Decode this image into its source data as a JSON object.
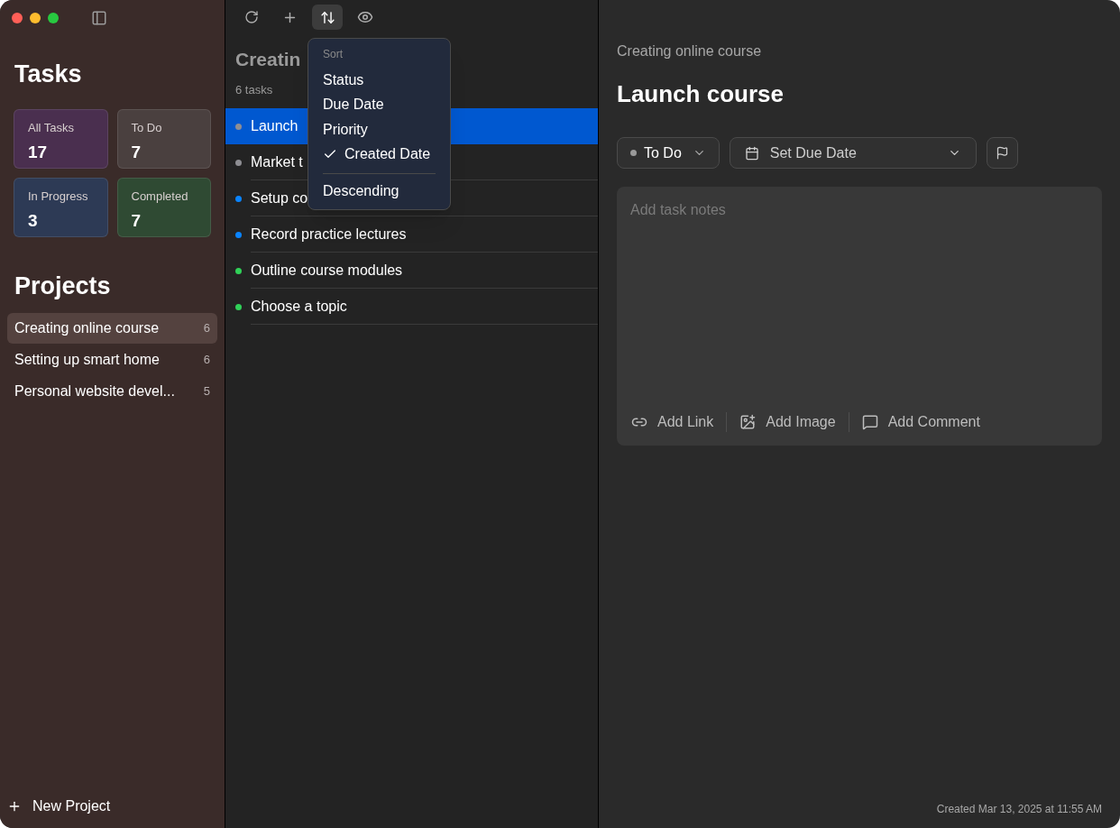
{
  "sidebar": {
    "title": "Tasks",
    "stats": [
      {
        "label": "All Tasks",
        "count": "17",
        "color": "#4a2f4f"
      },
      {
        "label": "To Do",
        "count": "7",
        "color": "#4a403f"
      },
      {
        "label": "In Progress",
        "count": "3",
        "color": "#2d3a55"
      },
      {
        "label": "Completed",
        "count": "7",
        "color": "#2f4a33"
      }
    ],
    "projects_title": "Projects",
    "projects": [
      {
        "name": "Creating online course",
        "count": "6",
        "selected": true
      },
      {
        "name": "Setting up smart home",
        "count": "6",
        "selected": false
      },
      {
        "name": "Personal website devel...",
        "count": "5",
        "selected": false
      }
    ],
    "new_project": "New Project"
  },
  "toolbar": [
    {
      "kind": "refresh",
      "active": false
    },
    {
      "kind": "add",
      "active": false
    },
    {
      "kind": "sort",
      "active": true
    },
    {
      "kind": "view",
      "active": false
    }
  ],
  "task_list": {
    "title": "Creatin",
    "count": "6 tasks",
    "tasks": [
      {
        "title": "Launch",
        "color": "#8e8e93",
        "selected": true
      },
      {
        "title": "Market t",
        "color": "#8e8e93",
        "selected": false
      },
      {
        "title": "Setup co",
        "color": "#0a84ff",
        "selected": false
      },
      {
        "title": "Record practice lectures",
        "color": "#0a84ff",
        "selected": false
      },
      {
        "title": "Outline course modules",
        "color": "#30d158",
        "selected": false
      },
      {
        "title": "Choose a topic",
        "color": "#30d158",
        "selected": false
      }
    ]
  },
  "sort_menu": {
    "header": "Sort",
    "options": [
      {
        "label": "Status",
        "checked": false
      },
      {
        "label": "Due Date",
        "checked": false
      },
      {
        "label": "Priority",
        "checked": false
      },
      {
        "label": "Created Date",
        "checked": true
      }
    ],
    "order": {
      "label": "Descending"
    }
  },
  "detail": {
    "project": "Creating online course",
    "title": "Launch course",
    "status": "To Do",
    "due_date": "Set Due Date",
    "notes_placeholder": "Add task notes",
    "actions": [
      {
        "kind": "link",
        "label": "Add Link"
      },
      {
        "kind": "image",
        "label": "Add Image"
      },
      {
        "kind": "comment",
        "label": "Add Comment"
      }
    ],
    "created": "Created Mar 13, 2025 at 11:55 AM"
  }
}
